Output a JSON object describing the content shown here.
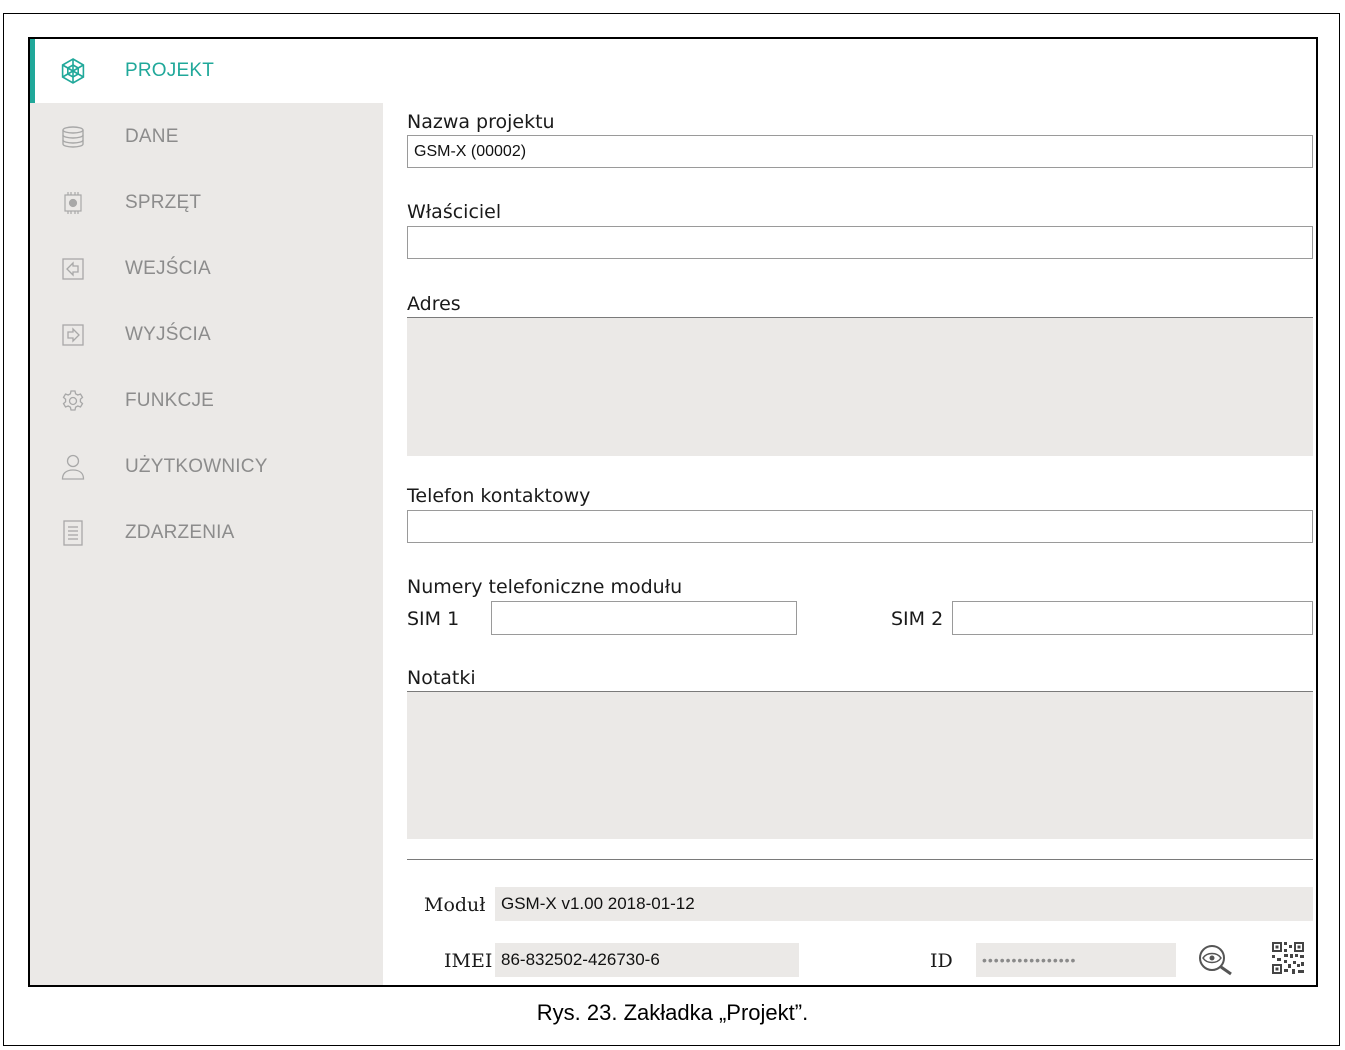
{
  "sidebar": {
    "items": [
      {
        "label": "PROJEKT",
        "icon": "project-logo-icon",
        "active": true
      },
      {
        "label": "DANE",
        "icon": "database-icon"
      },
      {
        "label": "SPRZĘT",
        "icon": "hardware-chip-icon"
      },
      {
        "label": "WEJŚCIA",
        "icon": "input-icon"
      },
      {
        "label": "WYJŚCIA",
        "icon": "output-icon"
      },
      {
        "label": "FUNKCJE",
        "icon": "gear-icon"
      },
      {
        "label": "UŻYTKOWNICY",
        "icon": "user-icon"
      },
      {
        "label": "ZDARZENIA",
        "icon": "events-list-icon"
      }
    ]
  },
  "form": {
    "project_name_label": "Nazwa projektu",
    "project_name_value": "GSM-X (00002)",
    "owner_label": "Właściciel",
    "owner_value": "",
    "address_label": "Adres",
    "address_value": "",
    "phone_label": "Telefon kontaktowy",
    "phone_value": "",
    "module_numbers_label": "Numery telefoniczne modułu",
    "sim1_label": "SIM 1",
    "sim1_value": "",
    "sim2_label": "SIM 2",
    "sim2_value": "",
    "notes_label": "Notatki",
    "notes_value": ""
  },
  "info": {
    "module_label": "Moduł",
    "module_value": "GSM-X v1.00 2018-01-12",
    "imei_label": "IMEI",
    "imei_value": "86-832502-426730-6",
    "id_label": "ID",
    "id_value": "••••••••••••••••"
  },
  "caption": "Rys. 23. Zakładka „Projekt”.",
  "colors": {
    "accent": "#20a89a",
    "sidebar_bg": "#ebe9e7"
  }
}
